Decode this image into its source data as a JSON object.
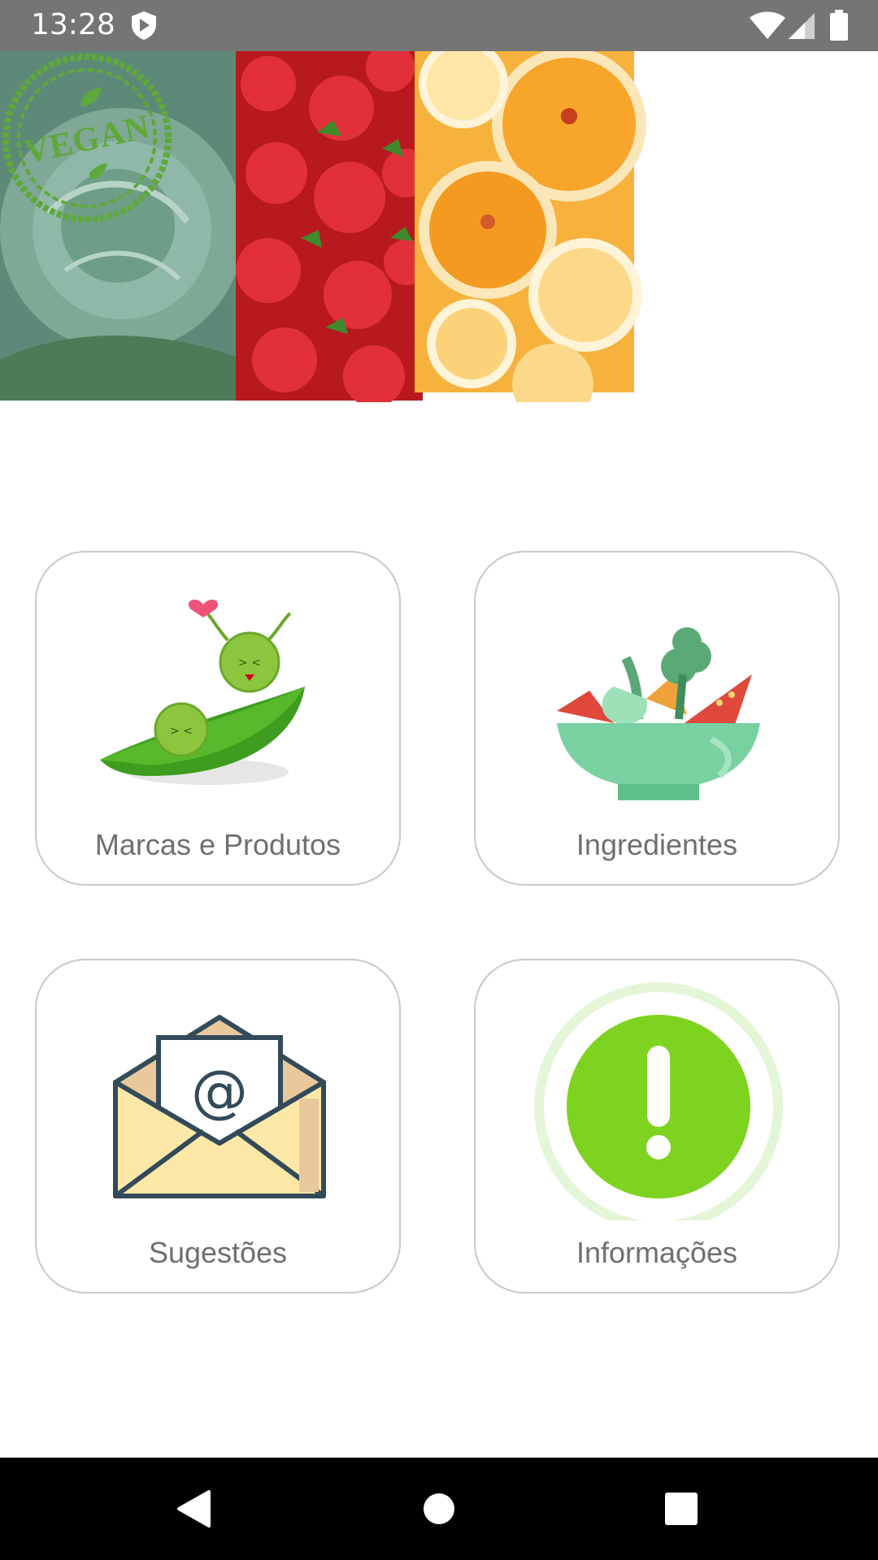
{
  "status_bar": {
    "time": "13:28",
    "icons": [
      "shield-icon",
      "wifi-icon",
      "signal-icon",
      "battery-icon"
    ]
  },
  "banner": {
    "images": [
      "cabbage",
      "strawberries",
      "oranges"
    ],
    "stamp_text": "VEGAN",
    "stamp_color": "#5fa83a"
  },
  "menu": {
    "cards": [
      {
        "label": "Marcas e Produtos",
        "icon": "pea-pod-icon"
      },
      {
        "label": "Ingredientes",
        "icon": "salad-bowl-icon"
      },
      {
        "label": "Sugestões",
        "icon": "envelope-email-icon"
      },
      {
        "label": "Informações",
        "icon": "info-exclamation-icon"
      }
    ]
  },
  "navigation": {
    "buttons": [
      "back-icon",
      "home-icon",
      "recents-icon"
    ]
  },
  "colors": {
    "status_bar": "#757575",
    "card_border": "#c8c8c8",
    "label_text": "#6f6f6f",
    "info_green": "#7ed321",
    "salad_bowl": "#79d0a0",
    "nav_bar": "#000000"
  }
}
